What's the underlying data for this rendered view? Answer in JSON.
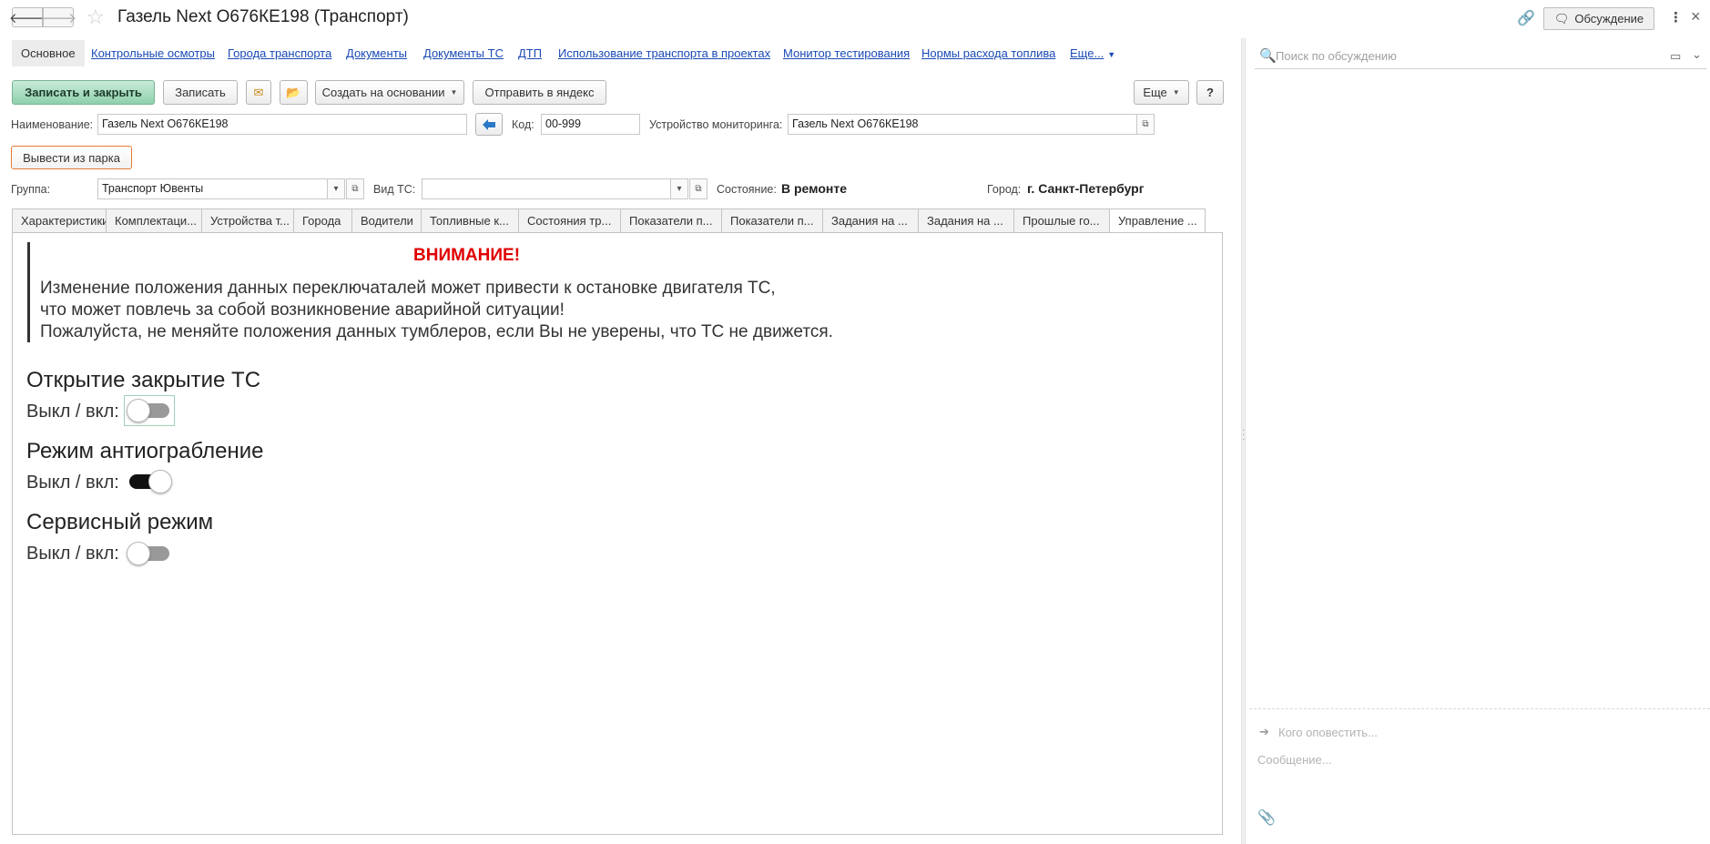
{
  "window": {
    "title": "Газель Next О676КЕ198 (Транспорт)",
    "back_icon": "arrow-left-icon",
    "forward_icon": "arrow-right-icon",
    "back_glyph": "🡐",
    "forward_glyph": "🡒",
    "favorite_glyph": "☆",
    "link_glyph": "🔗",
    "discuss_glyph": "🗨",
    "kebab_glyph": "⋮",
    "close_glyph": "×",
    "discuss_label": "Обсуждение"
  },
  "nav": {
    "active": "Основное",
    "links": [
      "Контрольные осмотры",
      "Города транспорта",
      "Документы",
      "Документы ТС",
      "ДТП",
      "Использование транспорта в проектах",
      "Монитор тестирования",
      "Нормы расхода топлива"
    ],
    "more": "Еще...",
    "more_glyph": "▼"
  },
  "toolbar": {
    "save_close": "Записать и закрыть",
    "save": "Записать",
    "mail_glyph": "✉",
    "folder_glyph": "📂",
    "create_based": "Создать на основании",
    "send_yandex": "Отправить в яндекс",
    "more": "Еще",
    "help": "?",
    "caret": "▼"
  },
  "form": {
    "name_label": "Наименование:",
    "name_value": "Газель Next О676КЕ198",
    "code_label": "Код:",
    "code_value": "00-999",
    "device_label": "Устройство мониторинга:",
    "device_value": "Газель Next О676КЕ198",
    "remove_park": "Вывести из парка",
    "group_label": "Группа:",
    "group_value": "Транспорт Ювенты",
    "type_label": "Вид ТС:",
    "type_value": "",
    "state_label": "Состояние:",
    "state_value": "В ремонте",
    "city_label": "Город:",
    "city_value": "г. Санкт-Петербург",
    "dropdown_glyph": "▾",
    "open_glyph": "⧉"
  },
  "tabs": [
    {
      "label": "Характеристики",
      "width": 103
    },
    {
      "label": "Комплектаци...",
      "width": 105
    },
    {
      "label": "Устройства т...",
      "width": 101
    },
    {
      "label": "Города",
      "width": 64
    },
    {
      "label": "Водители",
      "width": 76
    },
    {
      "label": "Топливные к...",
      "width": 107
    },
    {
      "label": "Состояния тр...",
      "width": 112
    },
    {
      "label": "Показатели п...",
      "width": 111
    },
    {
      "label": "Показатели п...",
      "width": 111
    },
    {
      "label": "Задания на ...",
      "width": 105
    },
    {
      "label": "Задания на ...",
      "width": 105
    },
    {
      "label": "Прошлые го...",
      "width": 105
    },
    {
      "label": "Управление ...",
      "width": 106
    }
  ],
  "panel": {
    "warning_title": "ВНИМАНИЕ!",
    "warning_lines": [
      "Изменение положения данных переключаталей может привести к остановке двигателя ТС,",
      "что может повлечь за собой возникновение аварийной ситуации!",
      "Пожалуйста, не меняйте положения данных тумблеров, если Вы не уверены, что ТС не движется."
    ],
    "sections": [
      {
        "title": "Открытие закрытие ТС",
        "label": "Выкл / вкл:",
        "on": false
      },
      {
        "title": "Режим антиограбление",
        "label": "Выкл / вкл:",
        "on": true
      },
      {
        "title": "Сервисный режим",
        "label": "Выкл / вкл:",
        "on": false
      }
    ]
  },
  "discussion": {
    "search_placeholder": "Поиск по обсуждению",
    "notify_placeholder": "Кого оповестить...",
    "message_placeholder": "Сообщение...",
    "search_glyph": "🔍",
    "video_glyph": "▭",
    "chevron_glyph": "⌄",
    "arrow_glyph": "➔",
    "clip_glyph": "📎"
  }
}
